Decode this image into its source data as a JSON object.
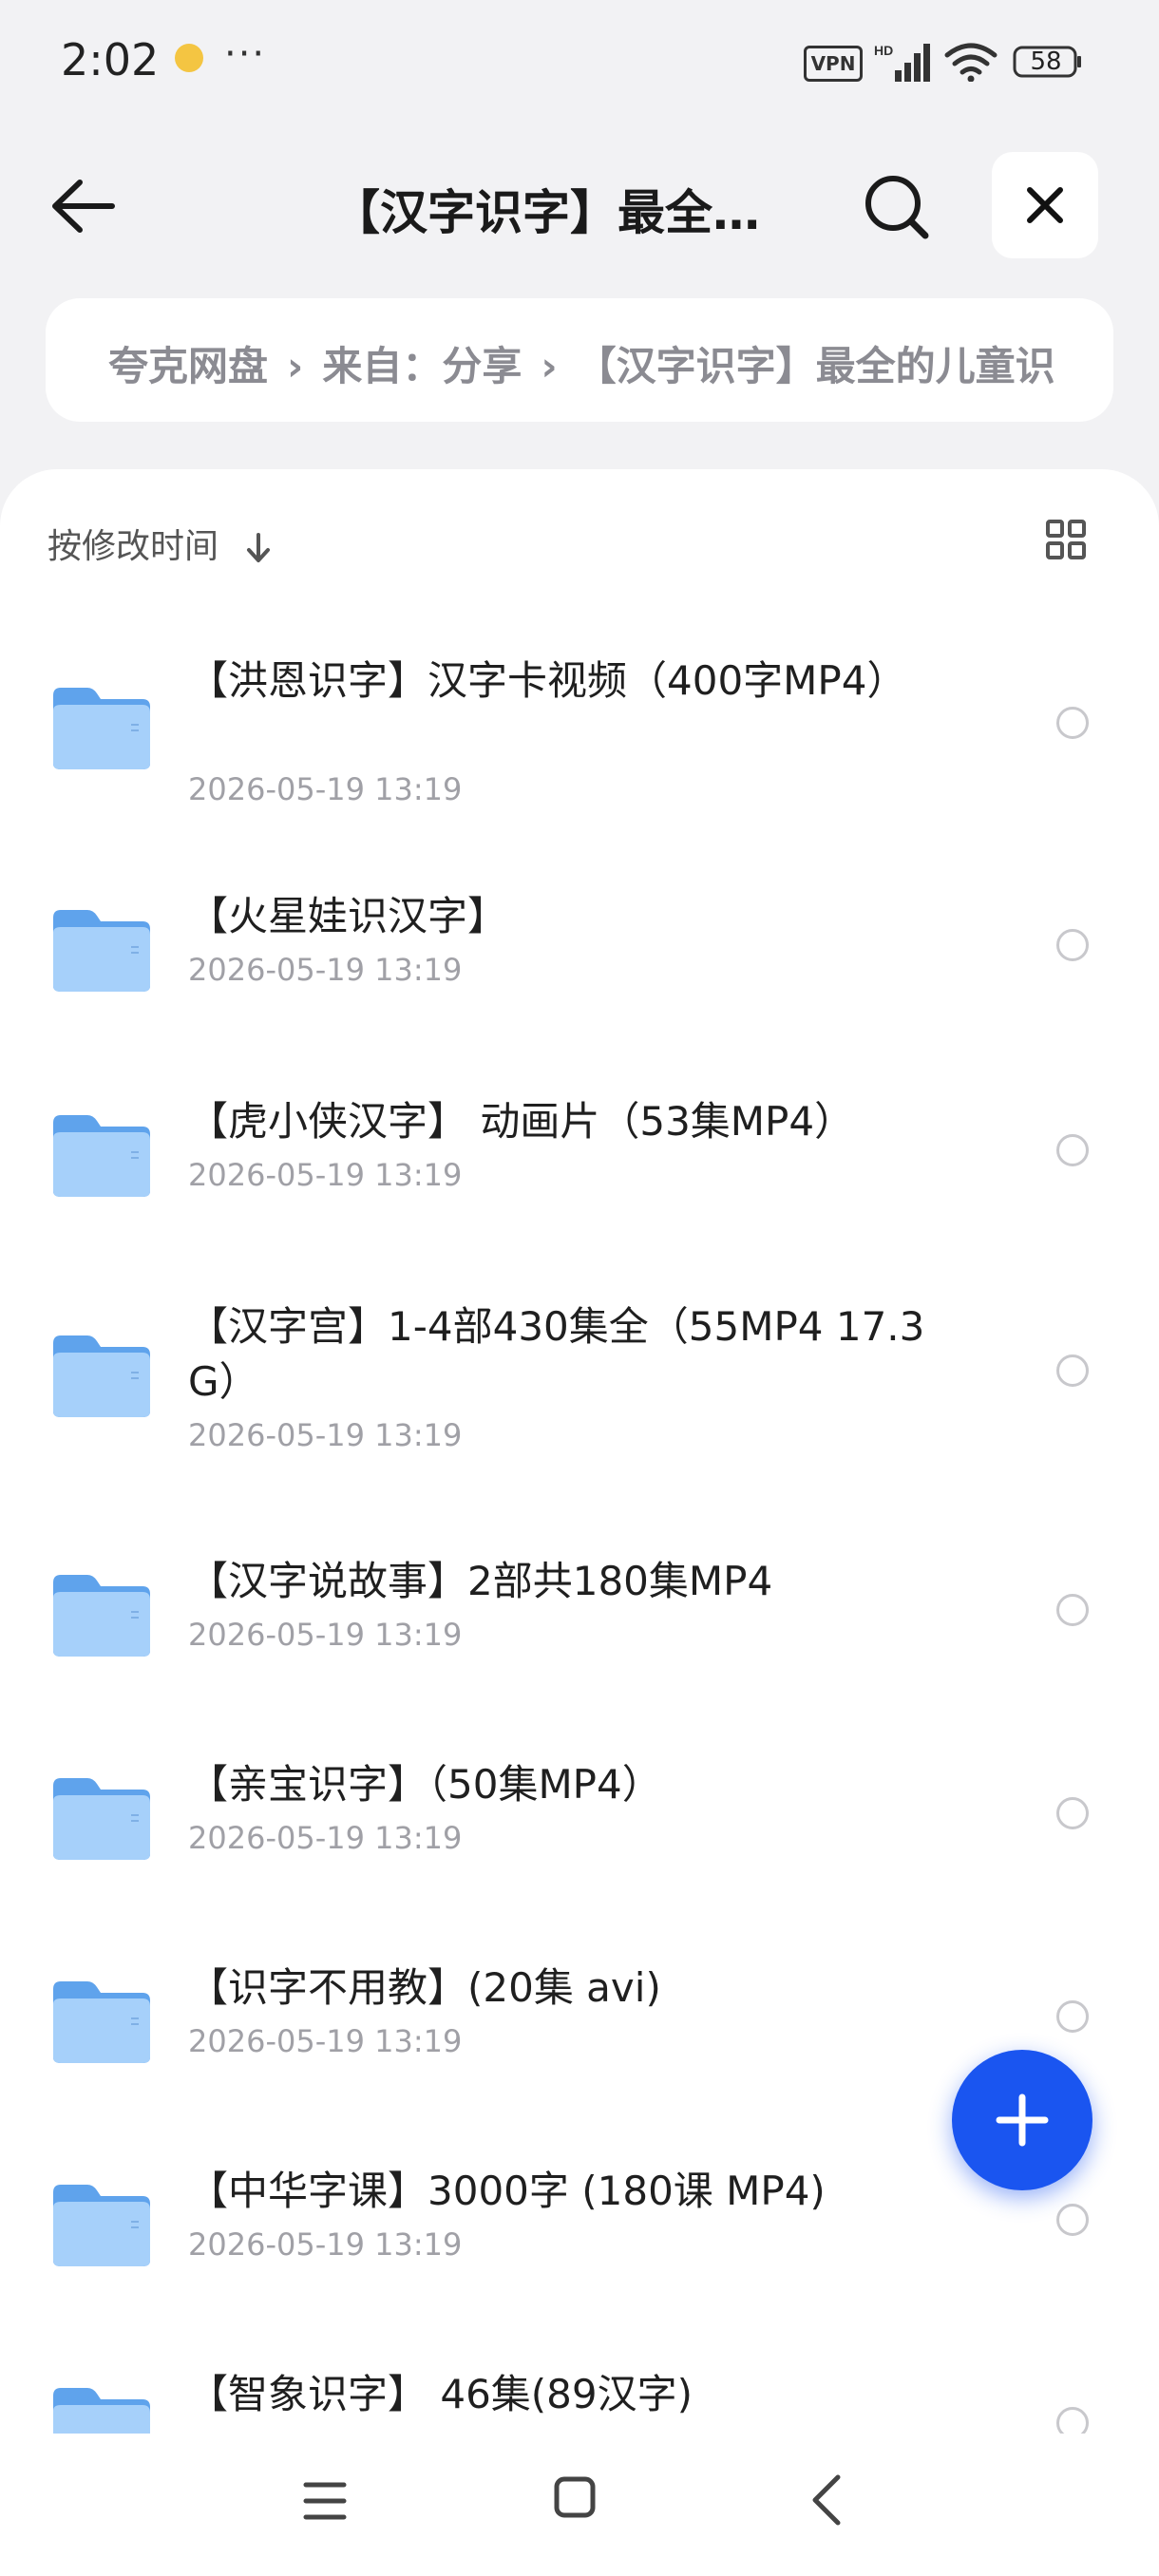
{
  "status_bar": {
    "time": "2:02",
    "dots": "···",
    "vpn": "VPN",
    "battery": "58"
  },
  "header": {
    "title": "【汉字识字】最全的儿童识字视频",
    "icons": {
      "back": "back-arrow-icon",
      "search": "search-icon",
      "close": "close-icon"
    }
  },
  "breadcrumb": {
    "items": [
      "夸克网盘",
      "来自：分享",
      "【汉字识字】最全的儿童识字视频"
    ]
  },
  "sort": {
    "label": "按修改时间",
    "icons": {
      "direction": "arrow-down-icon",
      "view": "grid-view-icon"
    }
  },
  "files": [
    {
      "name": "【洪恩识字】汉字卡视频（400字MP4）",
      "date": "2026-05-19 13:19"
    },
    {
      "name": "【火星娃识汉字】",
      "date": "2026-05-19 13:19"
    },
    {
      "name": "【虎小侠汉字】 动画片（53集MP4）",
      "date": "2026-05-19 13:19"
    },
    {
      "name": "【汉字宫】1-4部430集全（55MP4 17.3G）",
      "date": "2026-05-19 13:19"
    },
    {
      "name": "【汉字说故事】2部共180集MP4",
      "date": "2026-05-19 13:19"
    },
    {
      "name": "【亲宝识字】（50集MP4）",
      "date": "2026-05-19 13:19"
    },
    {
      "name": "【识字不用教】(20集 avi)",
      "date": "2026-05-19 13:19"
    },
    {
      "name": "【中华字课】3000字 (180课 MP4)",
      "date": "2026-05-19 13:19"
    },
    {
      "name": "【智象识字】 46集(89汉字)",
      "date": ""
    }
  ],
  "fab": {
    "icon": "plus-icon"
  },
  "colors": {
    "accent": "#1a55f0",
    "folder": "#7fb7f2",
    "background": "#f2f2f4"
  },
  "nav": {
    "icons": [
      "menu-icon",
      "home-icon",
      "back-icon"
    ]
  }
}
